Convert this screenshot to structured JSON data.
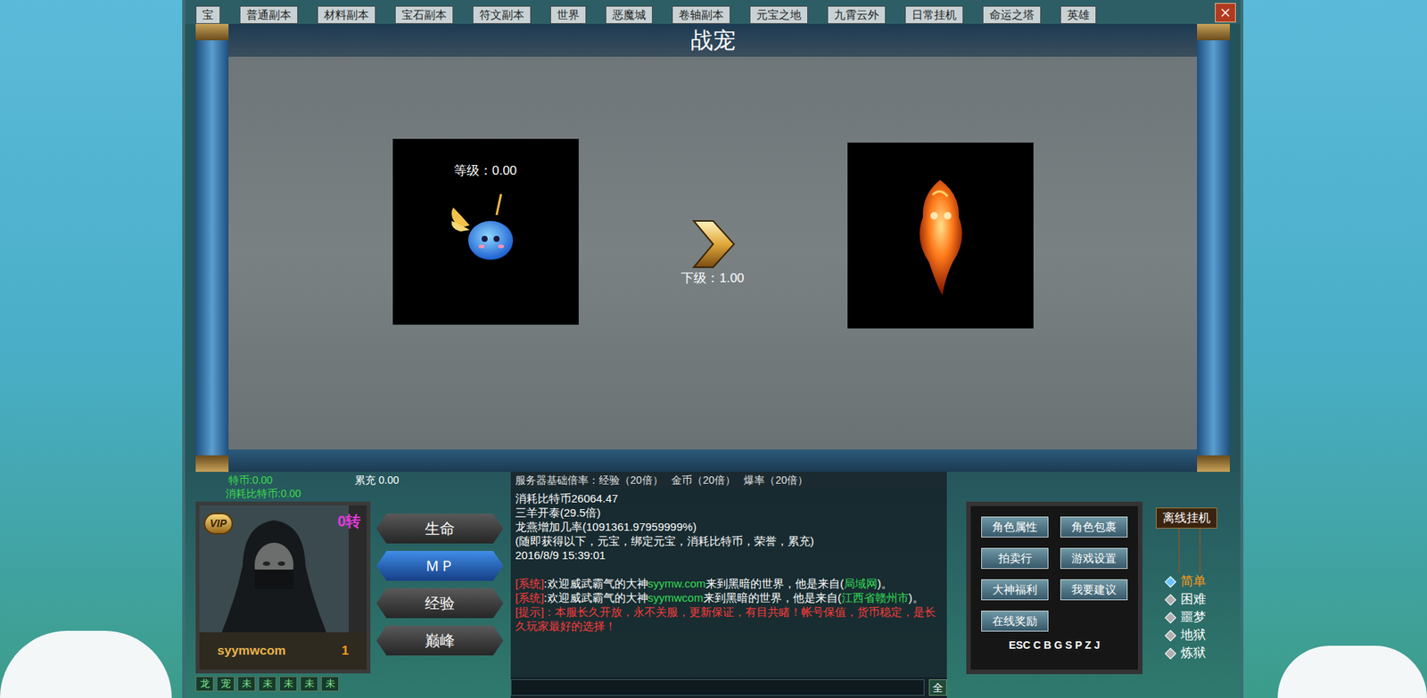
{
  "tabs": [
    {
      "label": "宝",
      "selected": false
    },
    {
      "label": "普通副本",
      "selected": false
    },
    {
      "label": "材料副本",
      "selected": false
    },
    {
      "label": "宝石副本",
      "selected": false
    },
    {
      "label": "符文副本",
      "selected": false
    },
    {
      "label": "世界",
      "selected": false
    },
    {
      "label": "恶魔城",
      "selected": false
    },
    {
      "label": "卷轴副本",
      "selected": false
    },
    {
      "label": "元宝之地",
      "selected": false
    },
    {
      "label": "九霄云外",
      "selected": false
    },
    {
      "label": "日常挂机",
      "selected": false
    },
    {
      "label": "命运之塔",
      "selected": false
    },
    {
      "label": "英雄",
      "selected": false
    }
  ],
  "window": {
    "title": "战宠"
  },
  "pet": {
    "level_label": "等级：0.00",
    "next_label": "下级：1.00"
  },
  "stats": [
    {
      "text": "特币:0.00",
      "color": "#3bdc4a",
      "row": 1
    },
    {
      "text": "累充  0.00",
      "color": "#ffffff",
      "row": 1
    },
    {
      "text": "消耗比特币:0.00",
      "color": "#3bdc4a",
      "row": 2
    }
  ],
  "player": {
    "name": "syymwcom",
    "level": "1",
    "rebirth": "0转",
    "vip": "VIP"
  },
  "action_buttons": [
    {
      "label": "生命",
      "selected": false
    },
    {
      "label": "ＭＰ",
      "selected": true
    },
    {
      "label": "经验",
      "selected": false
    },
    {
      "label": "巅峰",
      "selected": false
    }
  ],
  "bottom_tabs": [
    "龙",
    "宠",
    "未",
    "未",
    "未",
    "未",
    "未"
  ],
  "chat": {
    "header": "服务器基础倍率：经验（20倍）   金币（20倍）   爆率（20倍）",
    "lines": [
      {
        "segments": [
          {
            "text": "消耗比特币26064.47",
            "color": "#ffffff"
          }
        ]
      },
      {
        "segments": [
          {
            "text": "三羊开泰(29.5倍)",
            "color": "#ffffff"
          }
        ]
      },
      {
        "segments": [
          {
            "text": "龙燕增加几率(1091361.97959999%)",
            "color": "#ffffff"
          }
        ]
      },
      {
        "segments": [
          {
            "text": "(随即获得以下，元宝，绑定元宝，消耗比特币，荣誉，累充)",
            "color": "#ffffff"
          }
        ]
      },
      {
        "segments": [
          {
            "text": "2016/8/9 15:39:01",
            "color": "#ffffff"
          }
        ]
      },
      {
        "segments": []
      },
      {
        "segments": [
          {
            "text": "[系统]",
            "color": "#ff3b3b"
          },
          {
            "text": ":欢迎威武霸气的大神",
            "color": "#ffffff"
          },
          {
            "text": "syymw.com",
            "color": "#33dd55"
          },
          {
            "text": "来到黑暗的世界，他是来自(",
            "color": "#ffffff"
          },
          {
            "text": "局域网",
            "color": "#33dd55"
          },
          {
            "text": ")。",
            "color": "#ffffff"
          }
        ]
      },
      {
        "segments": [
          {
            "text": "[系统]",
            "color": "#ff3b3b"
          },
          {
            "text": ":欢迎威武霸气的大神",
            "color": "#ffffff"
          },
          {
            "text": "syymwcom",
            "color": "#33dd55"
          },
          {
            "text": "来到黑暗的世界，他是来自(",
            "color": "#ffffff"
          },
          {
            "text": "江西省赣州市",
            "color": "#33dd55"
          },
          {
            "text": ")。",
            "color": "#ffffff"
          }
        ]
      },
      {
        "segments": [
          {
            "text": "[提示]：本服长久开放，永不关服，更新保证，有目共睹！帐号保值，货币稳定，是长久玩家最好的选择！",
            "color": "#ff3b3b"
          }
        ]
      }
    ],
    "send": "全"
  },
  "menu_buttons": [
    "角色属性",
    "角色包裹",
    "拍卖行",
    "游戏设置",
    "大神福利",
    "我要建议",
    "在线奖励"
  ],
  "hotkeys": "ESC C B G S P Z J",
  "offline_button": "离线挂机",
  "difficulties": [
    {
      "label": "简单",
      "selected": true
    },
    {
      "label": "困难",
      "selected": false
    },
    {
      "label": "噩梦",
      "selected": false
    },
    {
      "label": "地狱",
      "selected": false
    },
    {
      "label": "炼狱",
      "selected": false
    }
  ]
}
